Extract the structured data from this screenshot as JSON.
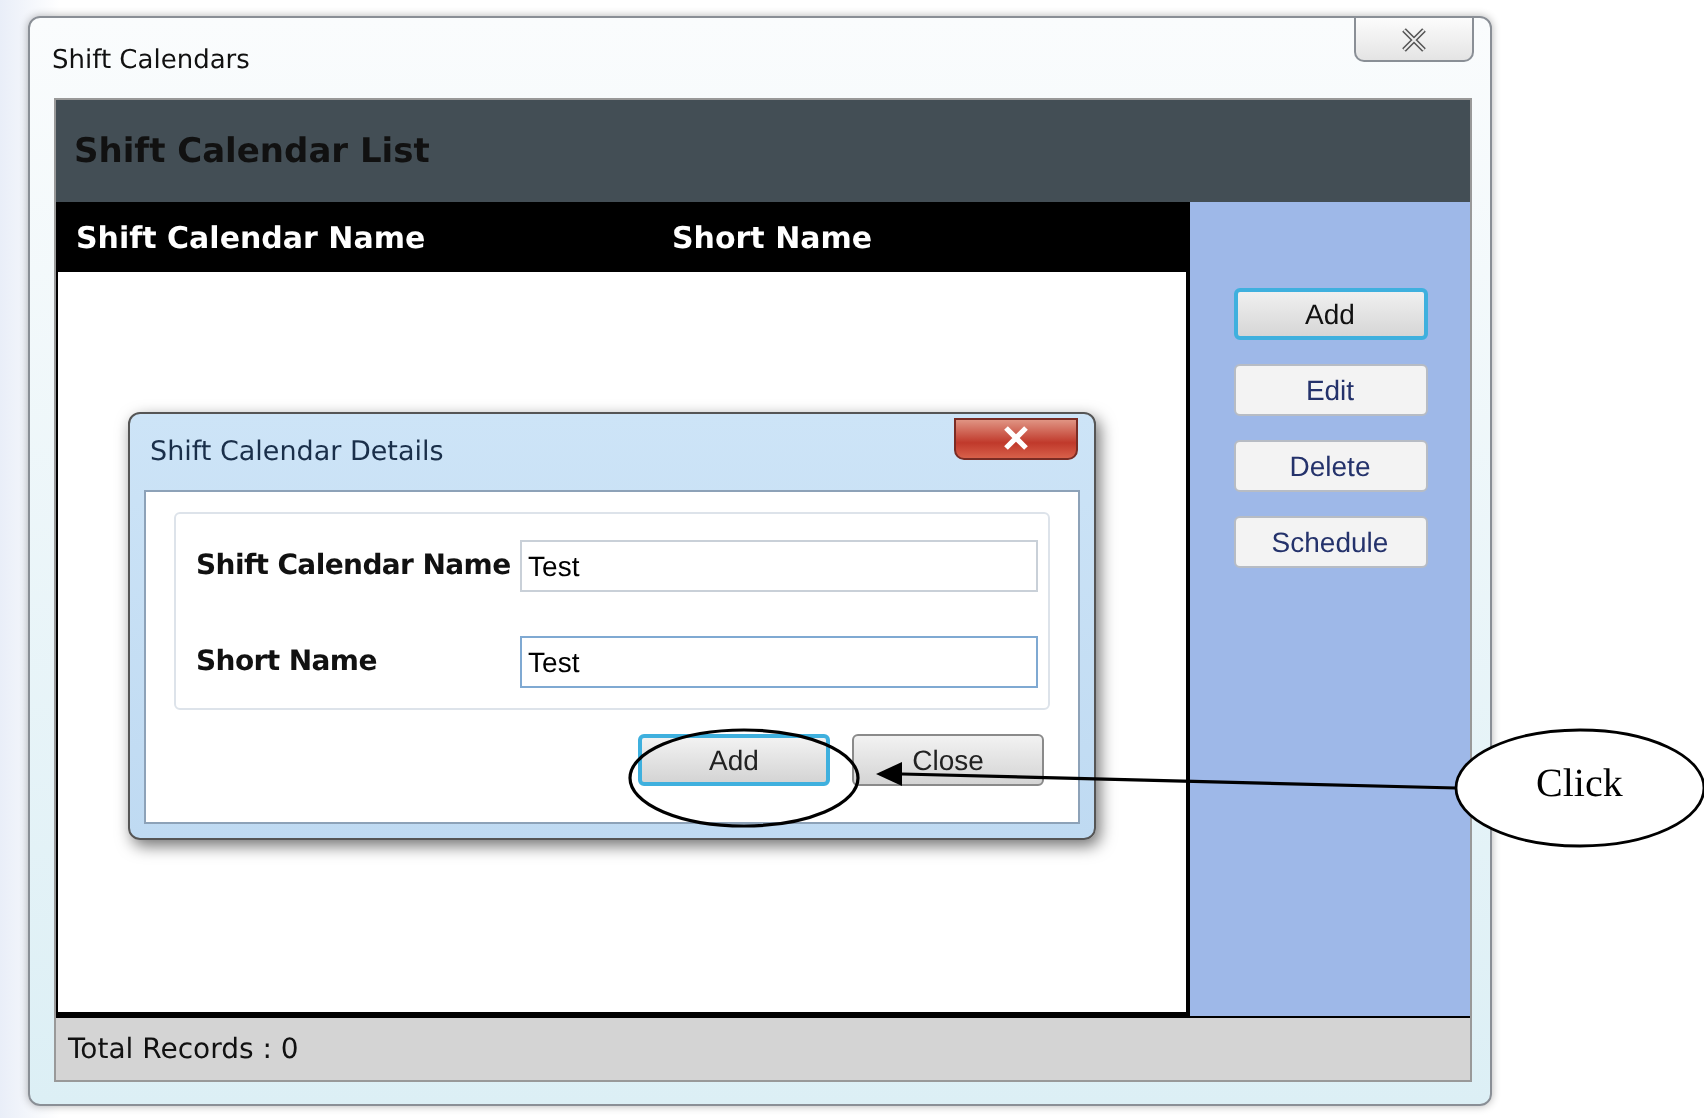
{
  "window": {
    "title": "Shift Calendars"
  },
  "list": {
    "title": "Shift Calendar List",
    "columns": [
      "Shift Calendar Name",
      "Short Name"
    ]
  },
  "side_buttons": [
    {
      "label": "Add",
      "focused": true
    },
    {
      "label": "Edit",
      "focused": false
    },
    {
      "label": "Delete",
      "focused": false
    },
    {
      "label": "Schedule",
      "focused": false
    }
  ],
  "status_bar": "Total Records :  0",
  "dialog": {
    "title": "Shift Calendar Details",
    "fields": [
      {
        "label": "Shift Calendar Name",
        "value": "Test",
        "focused": false
      },
      {
        "label": "Short Name",
        "value": "Test",
        "focused": true
      }
    ],
    "buttons": [
      {
        "label": "Add",
        "focused": true
      },
      {
        "label": "Close",
        "focused": false
      }
    ]
  },
  "callout": {
    "text": "Click"
  }
}
